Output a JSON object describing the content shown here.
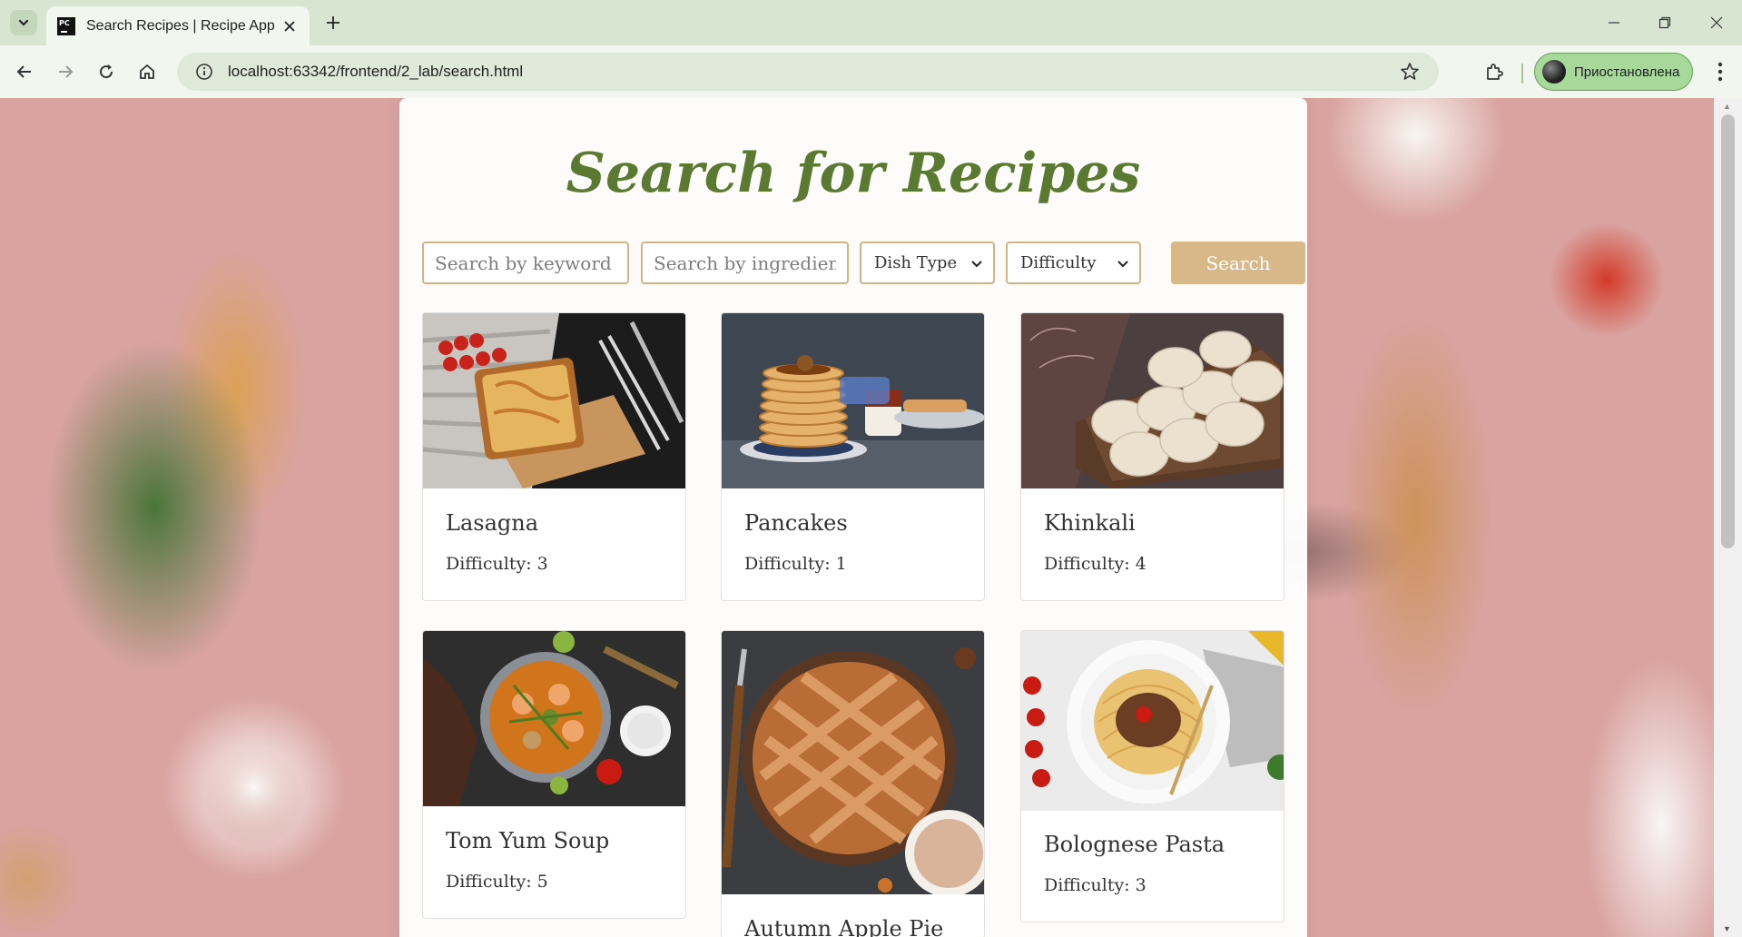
{
  "browser": {
    "tab_title": "Search Recipes | Recipe App",
    "favicon_text": "PC",
    "url": "localhost:63342/frontend/2_lab/search.html",
    "profile_label": "Приостановлена",
    "new_tab_symbol": "+",
    "close_symbol": "✕"
  },
  "page": {
    "title": "Search for Recipes",
    "search": {
      "keyword_placeholder": "Search by keyword",
      "ingredients_placeholder": "Search by ingredients",
      "dish_type_selected": "Dish Type",
      "difficulty_selected": "Difficulty",
      "button_label": "Search"
    },
    "recipes": [
      {
        "name": "Lasagna",
        "difficulty": "Difficulty: 3"
      },
      {
        "name": "Pancakes",
        "difficulty": "Difficulty: 1"
      },
      {
        "name": "Khinkali",
        "difficulty": "Difficulty: 4"
      },
      {
        "name": "Tom Yum Soup",
        "difficulty": "Difficulty: 5"
      },
      {
        "name": "Autumn Apple Pie",
        "difficulty": ""
      },
      {
        "name": "Bolognese Pasta",
        "difficulty": "Difficulty: 3"
      }
    ]
  },
  "colors": {
    "accent_title": "#5a7a32",
    "accent_border": "#d2b381",
    "button_bg": "#d8b888",
    "browser_frame": "#d8e6d1",
    "profile_chip": "#a6d99a"
  },
  "icons": [
    "tab-menu-icon",
    "close-icon",
    "plus-icon",
    "minimize-icon",
    "restore-icon",
    "window-close-icon",
    "back-icon",
    "forward-icon",
    "reload-icon",
    "home-icon",
    "site-info-icon",
    "star-icon",
    "extensions-icon",
    "more-menu-icon",
    "chevron-down-icon"
  ]
}
